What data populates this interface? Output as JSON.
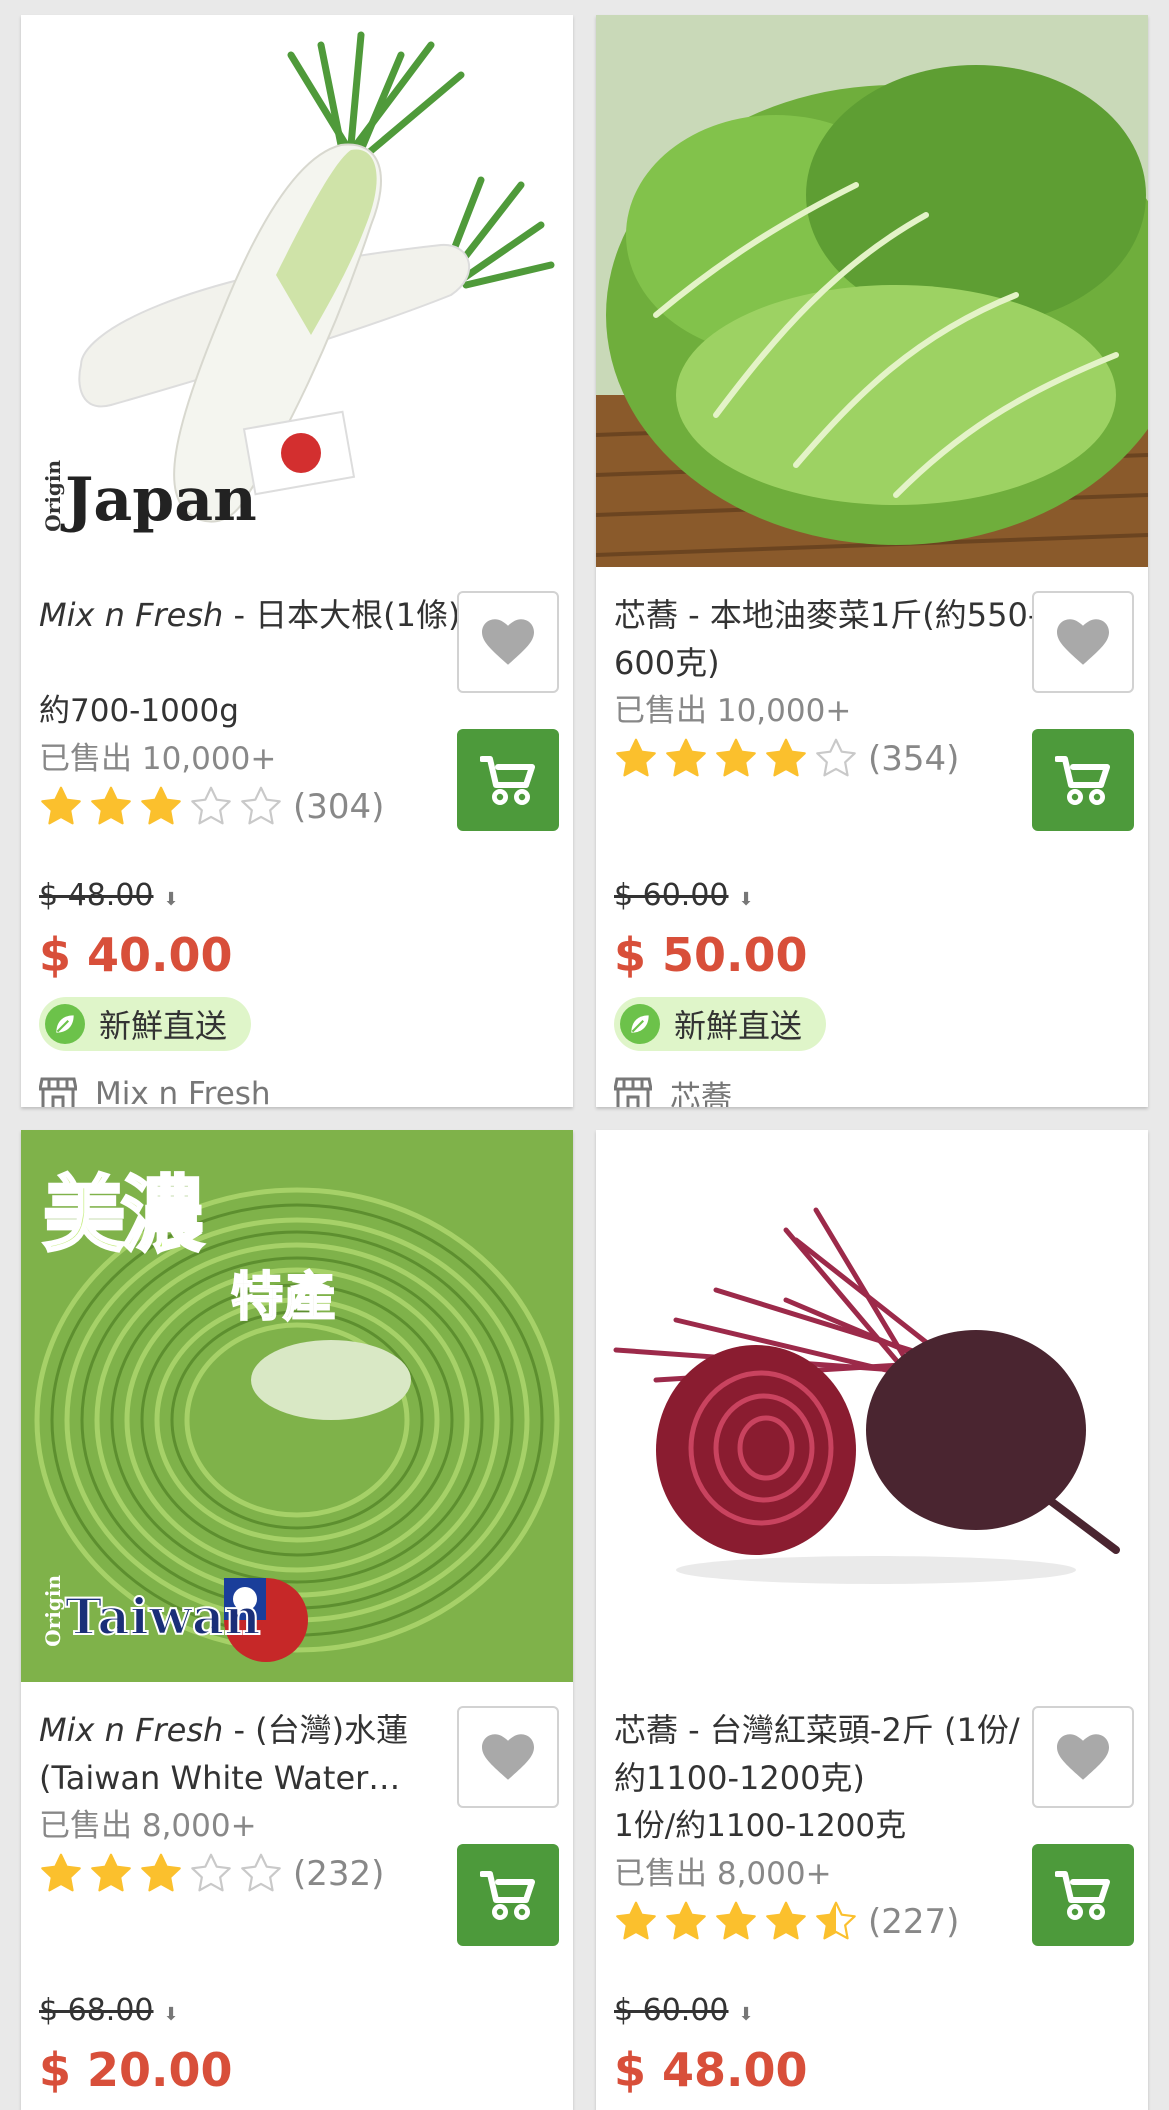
{
  "products": [
    {
      "brand": "Mix n Fresh",
      "name": " - 日本大根(1條)",
      "variant": "約700-1000g",
      "sold": "已售出 10,000+",
      "stars": 3,
      "rating_count": "(304)",
      "original_price": "$ 48.00",
      "price": "$ 40.00",
      "tag": "新鮮直送",
      "store": "Mix n Fresh",
      "image": {
        "origin_word": "Origin",
        "origin_place": "Japan"
      }
    },
    {
      "brand": "",
      "name": "芯蕎 - 本地油麥菜1斤(約550-600克)",
      "variant": "",
      "sold": "已售出 10,000+",
      "stars": 4,
      "rating_count": "(354)",
      "original_price": "$ 60.00",
      "price": "$ 50.00",
      "tag": "新鮮直送",
      "store": "芯蕎",
      "image": {}
    },
    {
      "brand": "Mix n Fresh",
      "name": " - (台灣)水蓮(Taiwan White Water…",
      "variant": "",
      "sold": "已售出 8,000+",
      "stars": 3,
      "rating_count": "(232)",
      "original_price": "$ 68.00",
      "price": "$ 20.00",
      "tag": "",
      "store": "",
      "image": {
        "origin_word": "Origin",
        "origin_place": "Taiwan",
        "overlay_1": "美濃",
        "overlay_2": "特產"
      }
    },
    {
      "brand": "",
      "name": "芯蕎 - 台灣紅菜頭-2斤 (1份/約1100-1200克)",
      "variant": "1份/約1100-1200克",
      "sold": "已售出 8,000+",
      "stars": 4.5,
      "rating_count": "(227)",
      "original_price": "$ 60.00",
      "price": "$ 48.00",
      "tag": "",
      "store": "",
      "image": {}
    }
  ],
  "icons": {
    "favorite": "heart-icon",
    "add_to_cart": "cart-icon",
    "store": "store-icon",
    "fresh": "leaf-icon",
    "price_drop": "down-arrow-icon"
  },
  "colors": {
    "price": "#d84f3a",
    "cart_button": "#4d9a3b",
    "fresh_tag_bg": "#dff5c9",
    "star": "#fbc02d"
  }
}
